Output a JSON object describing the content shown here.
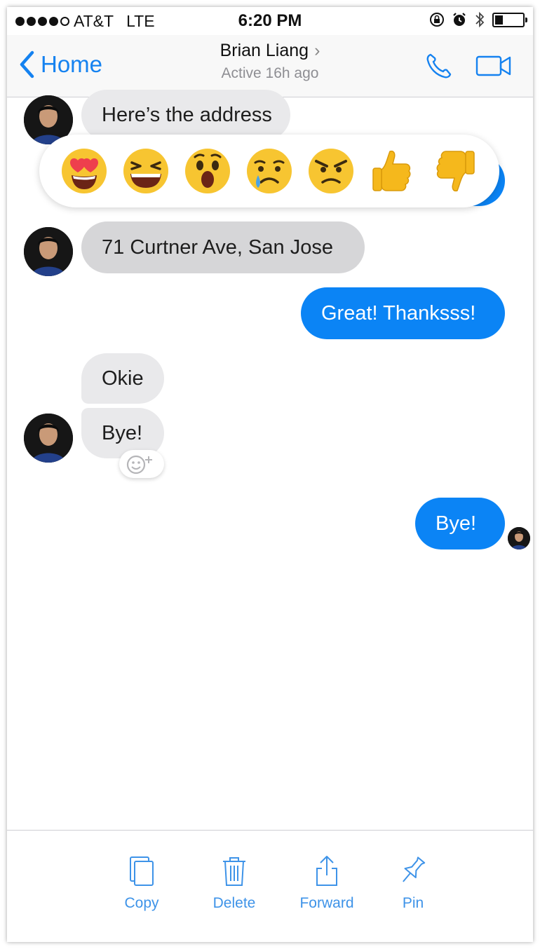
{
  "status_bar": {
    "carrier": "AT&T",
    "network": "LTE",
    "time": "6:20 PM",
    "signal_bars_filled": 4,
    "signal_bars_total": 5,
    "battery_level": 0.25
  },
  "nav": {
    "back_label": "Home",
    "contact_name": "Brian Liang",
    "contact_status": "Active 16h ago",
    "accent_color": "#1582f0"
  },
  "messages": [
    {
      "from": "contact",
      "text": "Here’s the address"
    },
    {
      "from": "me",
      "text": ""
    },
    {
      "from": "contact",
      "text": "71 Curtner Ave, San Jose"
    },
    {
      "from": "me",
      "text": "Great! Thanksss!"
    },
    {
      "from": "contact",
      "text": "Okie"
    },
    {
      "from": "contact",
      "text": "Bye!"
    },
    {
      "from": "me",
      "text": "Bye!"
    }
  ],
  "reactions": [
    "heart-eyes-emoji",
    "laughing-emoji",
    "wow-emoji",
    "sad-emoji",
    "angry-emoji",
    "thumbs-up-emoji",
    "thumbs-down-emoji"
  ],
  "toolbar": {
    "copy_label": "Copy",
    "delete_label": "Delete",
    "forward_label": "Forward",
    "pin_label": "Pin"
  },
  "colors": {
    "outgoing_bubble": "#0b84f5",
    "incoming_bubble": "#e9e9eb",
    "selected_bubble": "#d6d6d8",
    "toolbar_text": "#3e93e8"
  }
}
